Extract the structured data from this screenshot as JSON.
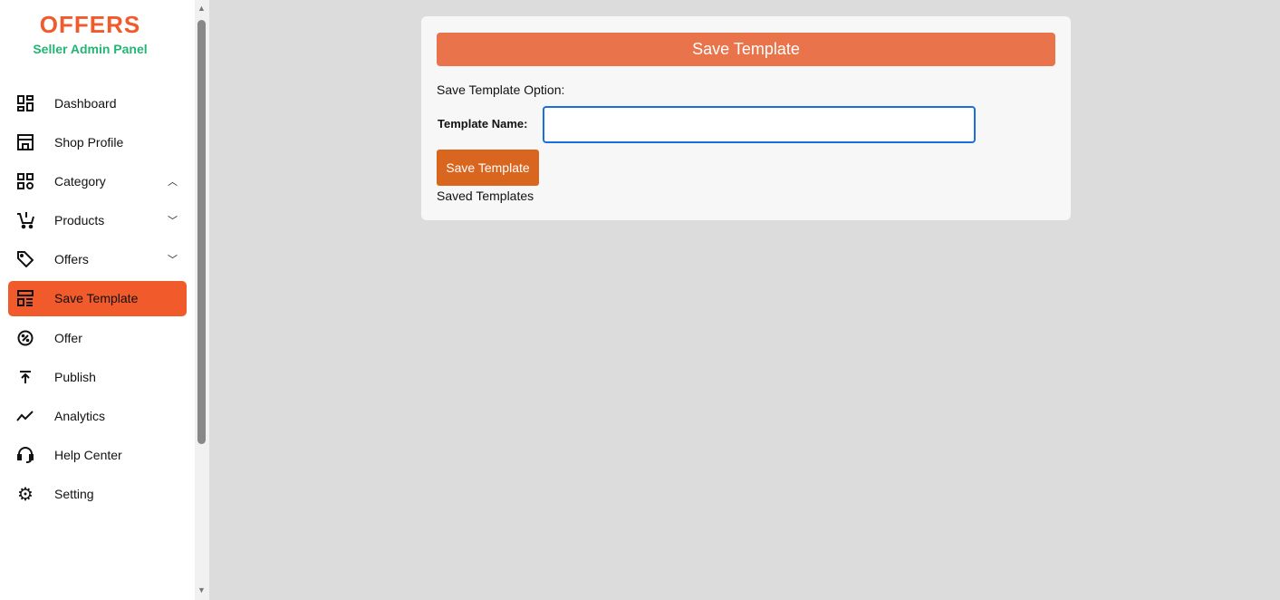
{
  "brand": {
    "logo": "OFFERS",
    "subtitle": "Seller Admin Panel",
    "accent": "#f15a2b"
  },
  "nav": [
    {
      "label": "Dashboard",
      "icon": "dashboard-icon"
    },
    {
      "label": "Shop Profile",
      "icon": "store-icon"
    },
    {
      "label": "Category",
      "icon": "category-icon",
      "chevron": "up"
    },
    {
      "label": "Products",
      "icon": "cart-icon",
      "chevron": "down"
    },
    {
      "label": "Offers",
      "icon": "tag-icon",
      "chevron": "down"
    },
    {
      "label": "Save Template",
      "icon": "template-icon",
      "active": true
    },
    {
      "label": "Offer",
      "icon": "discount-icon"
    },
    {
      "label": "Publish",
      "icon": "upload-icon"
    },
    {
      "label": "Analytics",
      "icon": "chart-line-icon"
    },
    {
      "label": "Help Center",
      "icon": "headset-icon"
    },
    {
      "label": "Setting",
      "icon": "gear-icon"
    }
  ],
  "card": {
    "header": "Save Template",
    "option_label": "Save Template Option:",
    "name_label": "Template Name:",
    "name_value": "",
    "button": "Save Template",
    "saved_label": "Saved Templates"
  }
}
